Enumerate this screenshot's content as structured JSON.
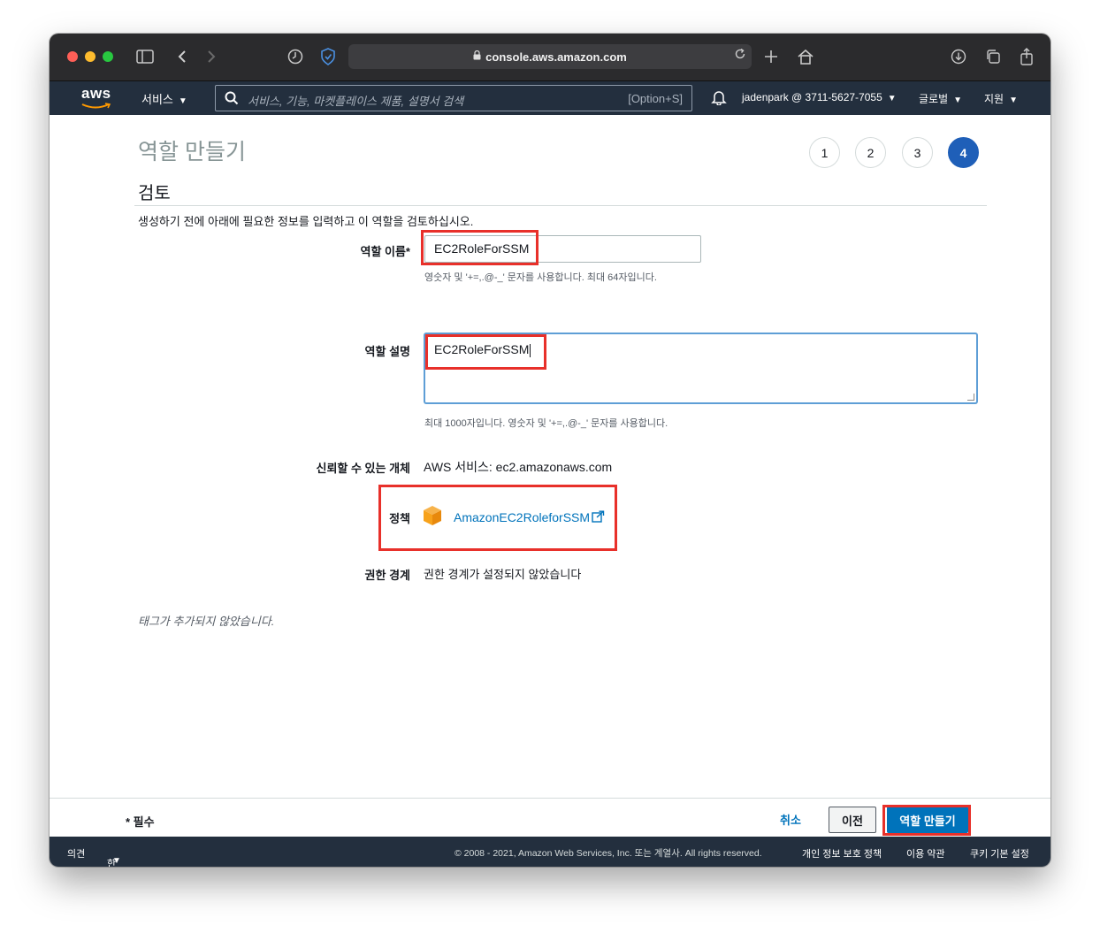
{
  "browser": {
    "url": "console.aws.amazon.com"
  },
  "aws_nav": {
    "logo": "aws",
    "services_label": "서비스",
    "search_placeholder": "서비스, 기능, 마켓플레이스 제품, 설명서 검색",
    "search_shortcut": "[Option+S]",
    "account": "jadenpark @ 3711-5627-7055",
    "region": "글로벌",
    "support": "지원"
  },
  "page": {
    "title": "역할 만들기",
    "steps": [
      "1",
      "2",
      "3",
      "4"
    ],
    "active_step": "4",
    "section_title": "검토",
    "intro": "생성하기 전에 아래에 필요한 정보를 입력하고 이 역할을 검토하십시오."
  },
  "form": {
    "role_name_label": "역할 이름*",
    "role_name_value": "EC2RoleForSSM",
    "role_name_hint": "영숫자 및 '+=,.@-_' 문자를 사용합니다. 최대 64자입니다.",
    "role_desc_label": "역할 설명",
    "role_desc_value": "EC2RoleForSSM",
    "role_desc_hint": "최대 1000자입니다. 영숫자 및 '+=,.@-_' 문자를 사용합니다.",
    "trusted_label": "신뢰할 수 있는 개체",
    "trusted_value": "AWS 서비스: ec2.amazonaws.com",
    "policy_label": "정책",
    "policy_value": "AmazonEC2RoleforSSM",
    "boundary_label": "권한 경계",
    "boundary_value": "권한 경계가 설정되지 않았습니다",
    "tags_note": "태그가 추가되지 않았습니다."
  },
  "actions": {
    "required_note": "* 필수",
    "cancel": "취소",
    "previous": "이전",
    "create": "역할 만들기"
  },
  "footer": {
    "feedback": "의견",
    "language": "한국어",
    "copyright": "© 2008 - 2021, Amazon Web Services, Inc. 또는 계열사. All rights reserved.",
    "privacy": "개인 정보 보호 정책",
    "terms": "이용 약관",
    "cookies": "쿠키 기본 설정"
  },
  "colors": {
    "aws_nav": "#232f3e",
    "primary": "#0073bb",
    "active_step": "#1f5fb8",
    "highlight": "#e8302a"
  }
}
